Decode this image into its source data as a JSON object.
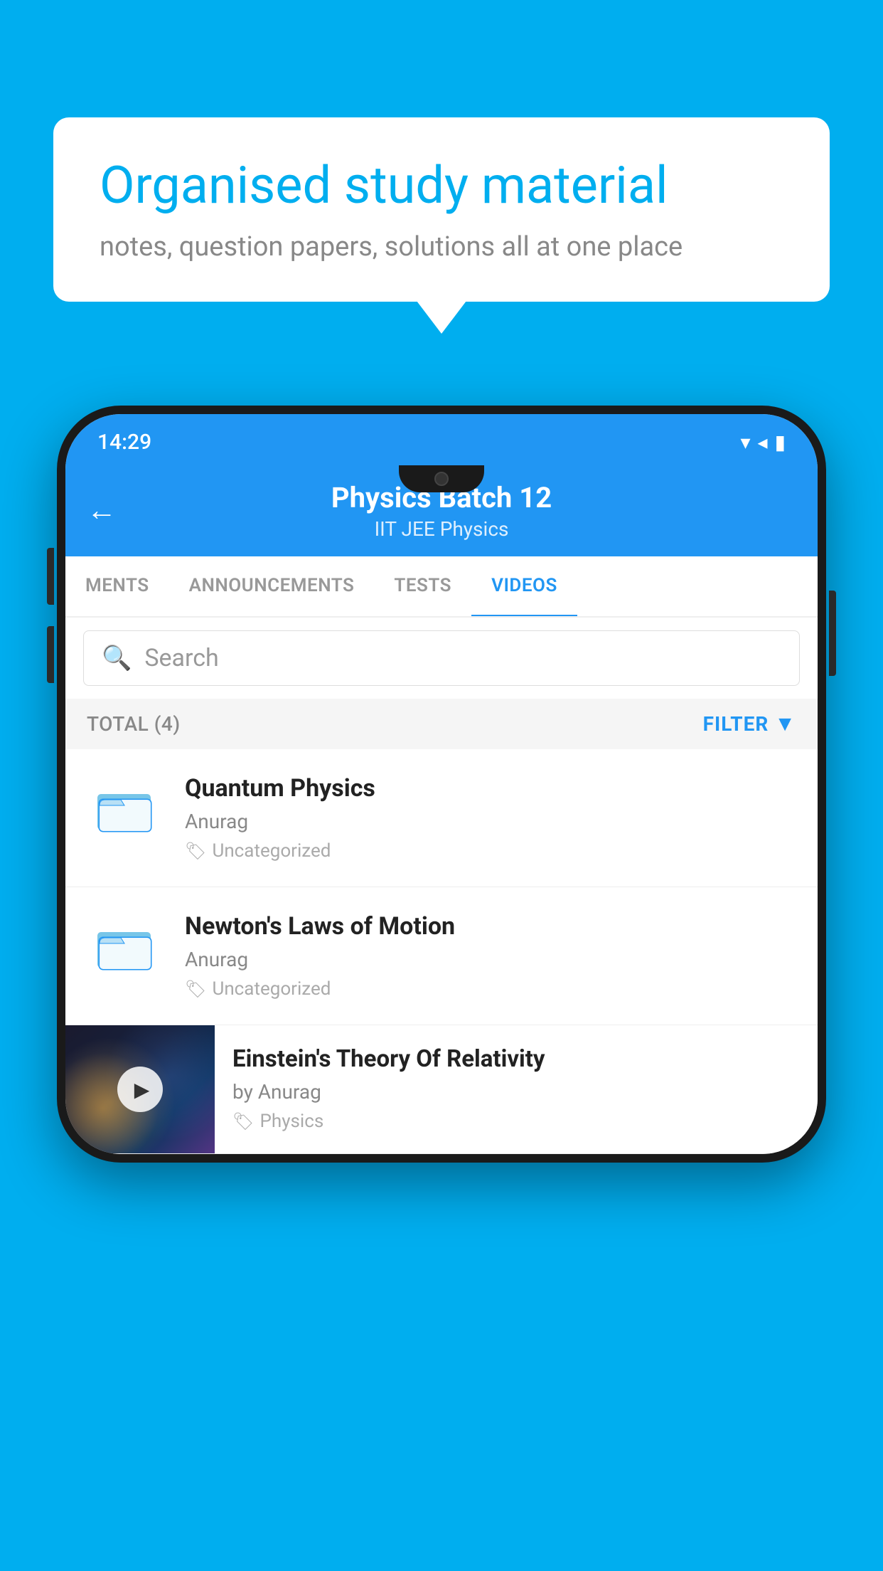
{
  "background": {
    "color": "#00AEEF"
  },
  "speech_bubble": {
    "title": "Organised study material",
    "subtitle": "notes, question papers, solutions all at one place"
  },
  "status_bar": {
    "time": "14:29",
    "wifi_icon": "▼",
    "signal_icon": "▲",
    "battery_icon": "▮"
  },
  "app_header": {
    "back_label": "←",
    "title": "Physics Batch 12",
    "subtitle": "IIT JEE   Physics"
  },
  "tabs": [
    {
      "label": "MENTS",
      "active": false
    },
    {
      "label": "ANNOUNCEMENTS",
      "active": false
    },
    {
      "label": "TESTS",
      "active": false
    },
    {
      "label": "VIDEOS",
      "active": true
    }
  ],
  "search": {
    "placeholder": "Search"
  },
  "filter_bar": {
    "total_label": "TOTAL (4)",
    "filter_label": "FILTER"
  },
  "videos": [
    {
      "id": 1,
      "title": "Quantum Physics",
      "author": "Anurag",
      "tag": "Uncategorized",
      "type": "folder"
    },
    {
      "id": 2,
      "title": "Newton's Laws of Motion",
      "author": "Anurag",
      "tag": "Uncategorized",
      "type": "folder"
    },
    {
      "id": 3,
      "title": "Einstein's Theory Of Relativity",
      "author": "by Anurag",
      "tag": "Physics",
      "type": "video"
    }
  ]
}
